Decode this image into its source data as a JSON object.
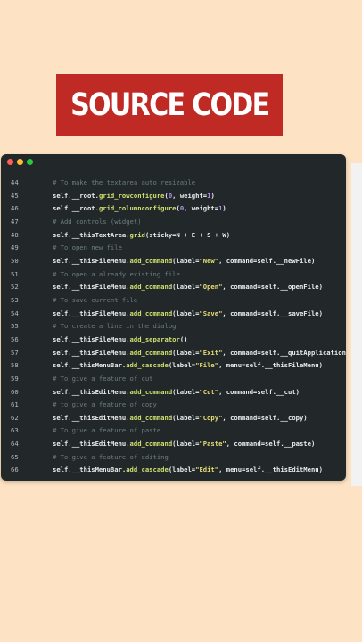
{
  "banner": {
    "title": "SOURCE CODE"
  },
  "editor": {
    "window_dots": [
      "red",
      "yellow",
      "green"
    ],
    "lines": [
      {
        "n": "44",
        "type": "comment",
        "text": "# To make the textarea auto resizable"
      },
      {
        "n": "45",
        "type": "code",
        "text": "self.__root.grid_rowconfigure(0, weight=1)"
      },
      {
        "n": "46",
        "type": "code",
        "text": "self.__root.grid_columnconfigure(0, weight=1)"
      },
      {
        "n": "47",
        "type": "comment",
        "text": "# Add controls (widget)"
      },
      {
        "n": "48",
        "type": "code",
        "text": "self.__thisTextArea.grid(sticky=N + E + S + W)"
      },
      {
        "n": "49",
        "type": "comment",
        "text": "# To open new file"
      },
      {
        "n": "50",
        "type": "code",
        "text": "self.__thisFileMenu.add_command(label=\"New\", command=self.__newFile)"
      },
      {
        "n": "51",
        "type": "comment",
        "text": "# To open a already existing file"
      },
      {
        "n": "52",
        "type": "code",
        "text": "self.__thisFileMenu.add_command(label=\"Open\", command=self.__openFile)"
      },
      {
        "n": "53",
        "type": "comment",
        "text": "# To save current file"
      },
      {
        "n": "54",
        "type": "code",
        "text": "self.__thisFileMenu.add_command(label=\"Save\", command=self.__saveFile)"
      },
      {
        "n": "55",
        "type": "comment",
        "text": "# To create a line in the dialog"
      },
      {
        "n": "56",
        "type": "code",
        "text": "self.__thisFileMenu.add_separator()"
      },
      {
        "n": "57",
        "type": "code",
        "text": "self.__thisFileMenu.add_command(label=\"Exit\", command=self.__quitApplication)"
      },
      {
        "n": "58",
        "type": "code",
        "text": "self.__thisMenuBar.add_cascade(label=\"File\", menu=self.__thisFileMenu)"
      },
      {
        "n": "59",
        "type": "comment",
        "text": "# To give a feature of cut"
      },
      {
        "n": "60",
        "type": "code",
        "text": "self.__thisEditMenu.add_command(label=\"Cut\", command=self.__cut)"
      },
      {
        "n": "61",
        "type": "comment",
        "text": "# to give a feature of copy"
      },
      {
        "n": "62",
        "type": "code",
        "text": "self.__thisEditMenu.add_command(label=\"Copy\", command=self.__copy)"
      },
      {
        "n": "63",
        "type": "comment",
        "text": "# To give a feature of paste"
      },
      {
        "n": "64",
        "type": "code",
        "text": "self.__thisEditMenu.add_command(label=\"Paste\", command=self.__paste)"
      },
      {
        "n": "65",
        "type": "comment",
        "text": "# To give a feature of editing"
      },
      {
        "n": "66",
        "type": "code",
        "text": "self.__thisMenuBar.add_cascade(label=\"Edit\", menu=self.__thisEditMenu)"
      }
    ]
  },
  "colors": {
    "background": "#fde3c3",
    "banner": "#bf2a25",
    "editor": "#22282a",
    "comment": "#6d7d80",
    "keyword": "#cfe06e",
    "number": "#b58cf0",
    "string": "#e6dc74"
  }
}
